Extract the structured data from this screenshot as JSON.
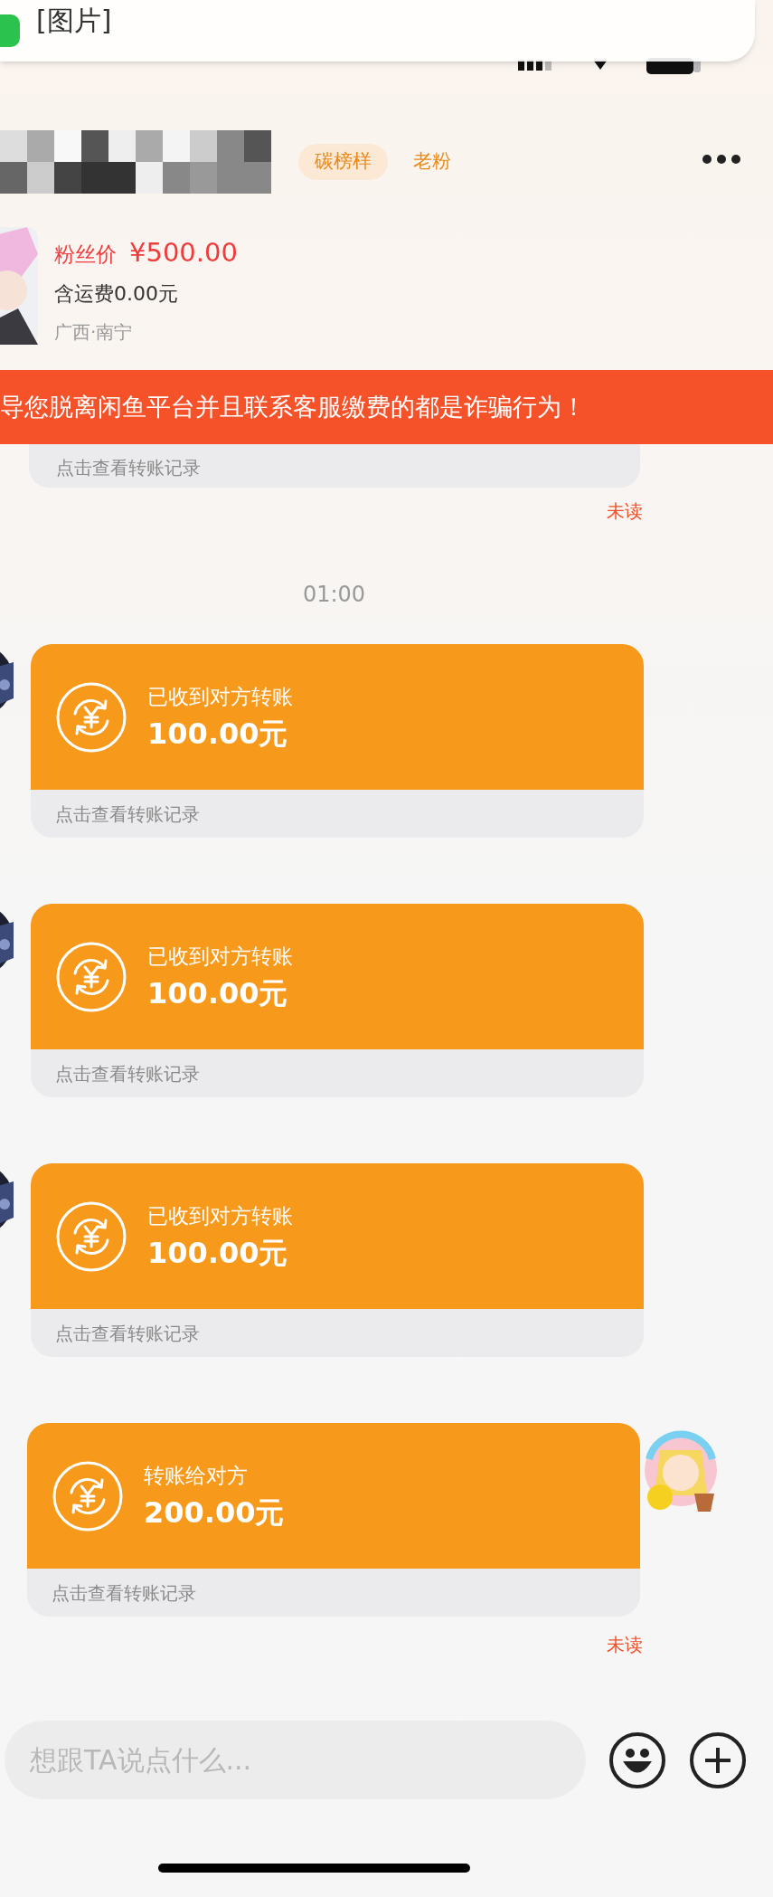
{
  "notification": {
    "text": "[图片]"
  },
  "header": {
    "tags": [
      {
        "label": "碳榜样",
        "kind": "pill"
      },
      {
        "label": "老粉",
        "kind": "plain"
      }
    ]
  },
  "product": {
    "price_label": "粉丝价",
    "price": "¥500.00",
    "shipping": "含运费0.00元",
    "location": "广西·南宁"
  },
  "warning": "导您脱离闲鱼平台并且联系客服缴费的都是诈骗行为！",
  "messages": [
    {
      "kind": "tail",
      "link": "点击查看转账记录",
      "unread": "未读"
    },
    {
      "kind": "time",
      "text": "01:00"
    },
    {
      "kind": "received",
      "title": "已收到对方转账",
      "amount": "100.00元",
      "link": "点击查看转账记录"
    },
    {
      "kind": "received",
      "title": "已收到对方转账",
      "amount": "100.00元",
      "link": "点击查看转账记录"
    },
    {
      "kind": "received",
      "title": "已收到对方转账",
      "amount": "100.00元",
      "link": "点击查看转账记录"
    },
    {
      "kind": "sent",
      "title": "转账给对方",
      "amount": "200.00元",
      "link": "点击查看转账记录",
      "unread": "未读"
    }
  ],
  "composer": {
    "placeholder": "想跟TA说点什么..."
  }
}
